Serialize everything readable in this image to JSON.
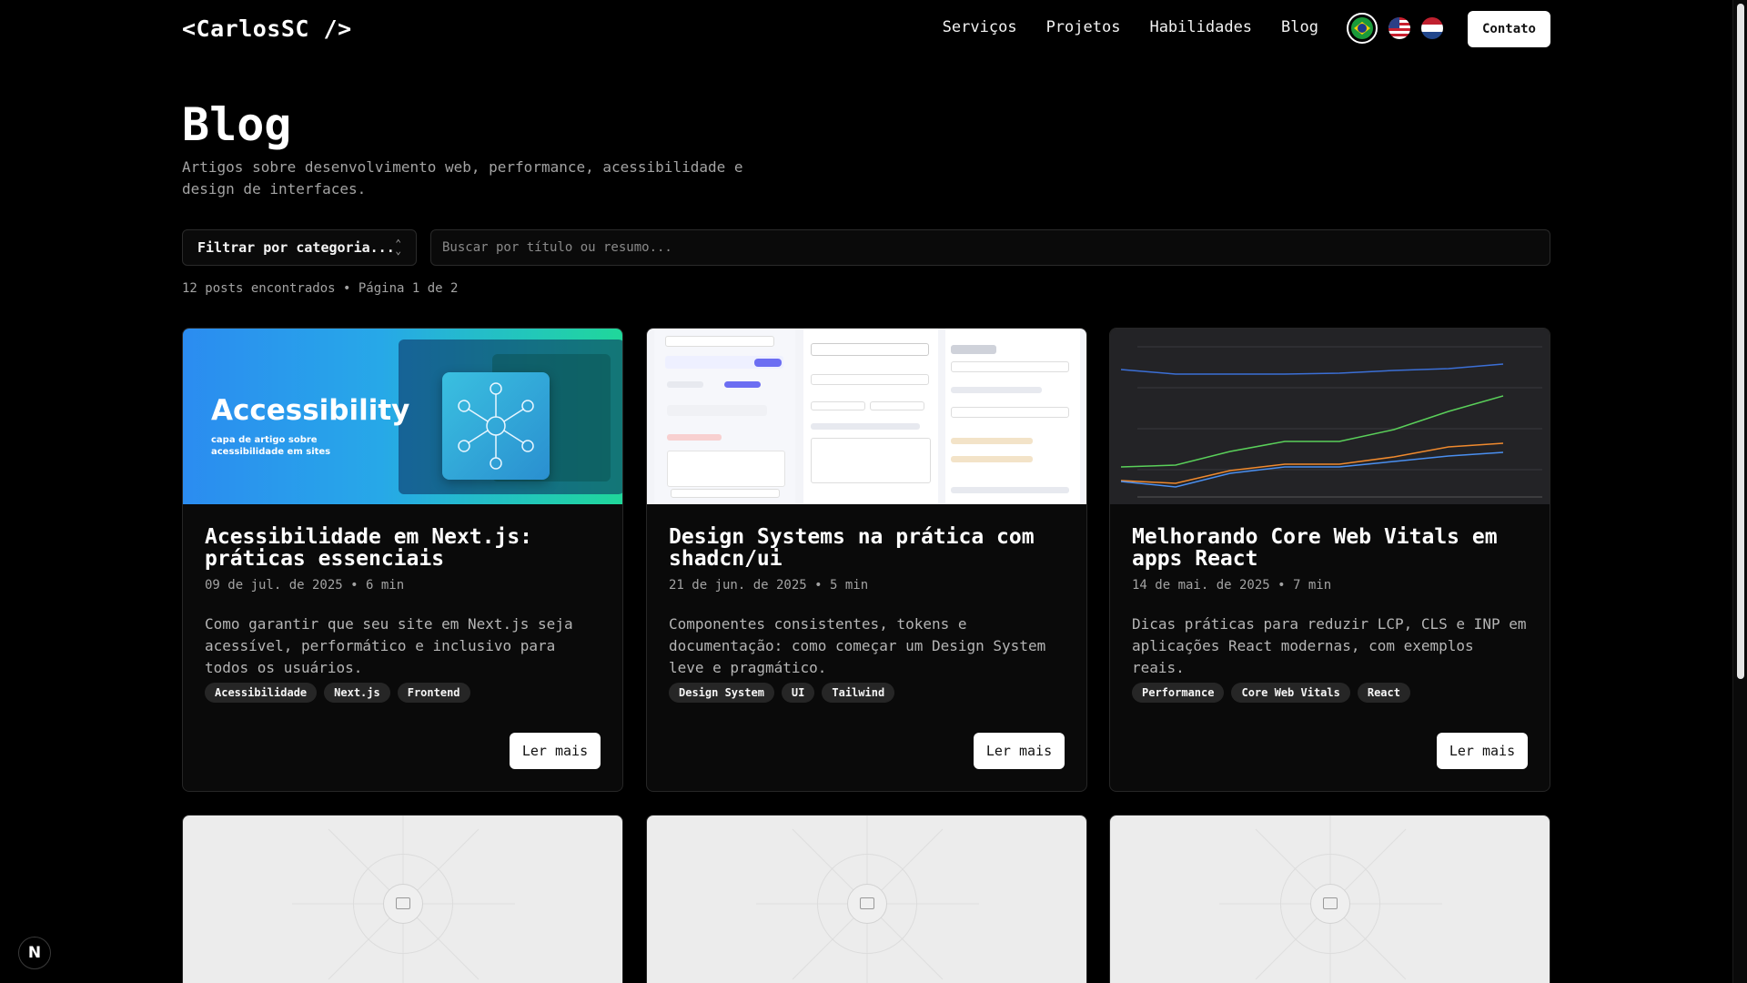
{
  "header": {
    "logo": "<CarlosSC />",
    "nav": [
      "Serviços",
      "Projetos",
      "Habilidades",
      "Blog"
    ],
    "languages": [
      "pt-BR",
      "en-US",
      "nl-NL"
    ],
    "active_language": "pt-BR",
    "contact_label": "Contato"
  },
  "main": {
    "title": "Blog",
    "subtitle": "Artigos sobre desenvolvimento web, performance, acessibilidade e design de interfaces.",
    "filter_label": "Filtrar por categoria...",
    "search_placeholder": "Buscar por título ou resumo...",
    "result_count": "12 posts encontrados • Página 1 de 2"
  },
  "posts": [
    {
      "title": "Acessibilidade em Next.js: práticas essenciais",
      "meta": "09 de jul. de 2025 • 6 min",
      "excerpt": "Como garantir que seu site em Next.js seja acessível, performático e inclusivo para todos os usuários.",
      "tags": [
        "Acessibilidade",
        "Next.js",
        "Frontend"
      ],
      "cover_title": "Accessibility",
      "cover_subtitle": "capa de artigo sobre acessibilidade em sites",
      "read_label": "Ler mais"
    },
    {
      "title": "Design Systems na prática com shadcn/ui",
      "meta": "21 de jun. de 2025 • 5 min",
      "excerpt": "Componentes consistentes, tokens e documentação: como começar um Design System leve e pragmático.",
      "tags": [
        "Design System",
        "UI",
        "Tailwind"
      ],
      "read_label": "Ler mais"
    },
    {
      "title": "Melhorando Core Web Vitals em apps React",
      "meta": "14 de mai. de 2025 • 7 min",
      "excerpt": "Dicas práticas para reduzir LCP, CLS e INP em aplicações React modernas, com exemplos reais.",
      "tags": [
        "Performance",
        "Core Web Vitals",
        "React"
      ],
      "read_label": "Ler mais"
    }
  ],
  "badge": "N",
  "colors": {
    "background": "#000000",
    "card": "#0a0a0a",
    "border": "#262626",
    "tag_bg": "#262626",
    "muted_text": "#a3a3a3"
  }
}
